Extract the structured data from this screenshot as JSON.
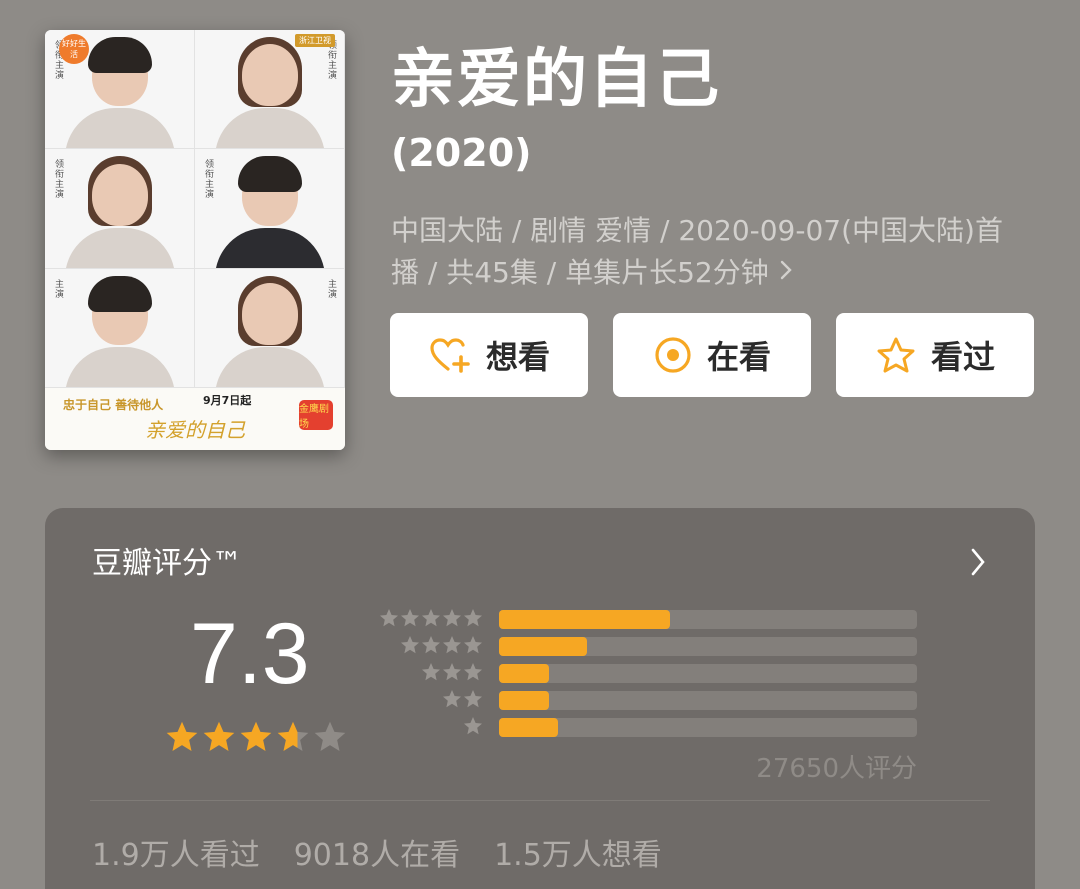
{
  "poster": {
    "slogan": "忠于自己 善待他人",
    "date": "9月7日起",
    "logo_text": "亲爱的自己",
    "badge": "好好生活",
    "top_tag": "浙江卫视",
    "gold_badge": "金鹰剧场"
  },
  "title": "亲爱的自己",
  "year": "(2020)",
  "meta": {
    "line": "中国大陆 / 剧情 爱情 / 2020-09-07(中国大陆)首播 / 共45集 / 单集片长52分钟",
    "chevron": "chevron-right-icon"
  },
  "buttons": {
    "want": "想看",
    "doing": "在看",
    "done": "看过"
  },
  "rating": {
    "title": "豆瓣评分™",
    "score": "7.3",
    "stars_value": 3.65,
    "count_text": "27650人评分",
    "distribution": [
      {
        "stars": 5,
        "fraction": 0.41
      },
      {
        "stars": 4,
        "fraction": 0.21
      },
      {
        "stars": 3,
        "fraction": 0.12
      },
      {
        "stars": 2,
        "fraction": 0.12
      },
      {
        "stars": 1,
        "fraction": 0.14
      }
    ],
    "stats": {
      "watched": "1.9万人看过",
      "watching": "9018人在看",
      "want": "1.5万人想看"
    }
  },
  "colors": {
    "background": "#8e8b87",
    "card": "#6f6b68",
    "accent": "#f6a723",
    "track": "#837f7b"
  }
}
